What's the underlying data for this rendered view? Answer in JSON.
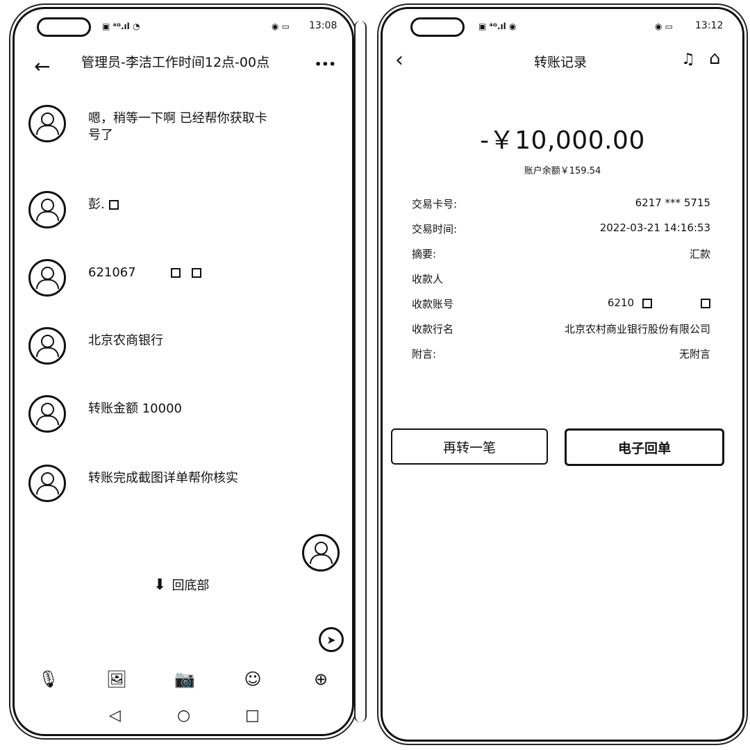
{
  "left_phone": {
    "status": {
      "time": "13:08",
      "signal": "▣ ⁴ᴳ.ıl ◔",
      "right_icons": "◉ ▭"
    },
    "header": {
      "title": "管理员-李洁工作时间12点-00点",
      "back_icon": "←",
      "more_icon": "•••"
    },
    "messages": [
      {
        "text": "嗯，稍等一下啊 已经帮你获取卡号了"
      },
      {
        "text": "彭."
      },
      {
        "text": "621067"
      },
      {
        "text": "北京农商银行"
      },
      {
        "text": "转账金额 10000"
      },
      {
        "text": "转账完成截图详单帮你核实"
      }
    ],
    "back_to_bottom": "回底部",
    "toolbar": {
      "mic": "🎙",
      "image": "🖼",
      "camera": "📷",
      "emoji": "☺",
      "plus": "⊕"
    },
    "navbar": {
      "back": "◁",
      "home": "○",
      "recent": "□"
    }
  },
  "right_phone": {
    "status": {
      "time": "13:12",
      "signal": "▣ ⁴ᴳ.ıl ◉",
      "right_icons": "◉ ▭"
    },
    "header": {
      "title": "转账记录",
      "back_icon": "‹",
      "service_icon": "♫",
      "home_icon": "⌂"
    },
    "amount": "-￥10,000.00",
    "balance": "账户余额￥159.54",
    "details": [
      {
        "label": "交易卡号:",
        "value": "6217 *** 5715"
      },
      {
        "label": "交易时间:",
        "value": "2022-03-21 14:16:53"
      },
      {
        "label": "摘要:",
        "value": "汇款"
      },
      {
        "label": "收款人",
        "value": ""
      },
      {
        "label": "收款账号",
        "value": "6210"
      },
      {
        "label": "收款行名",
        "value": "北京农村商业银行股份有限公司"
      },
      {
        "label": "附言:",
        "value": "无附言"
      }
    ],
    "buttons": {
      "again": "再转一笔",
      "receipt": "电子回单"
    }
  }
}
